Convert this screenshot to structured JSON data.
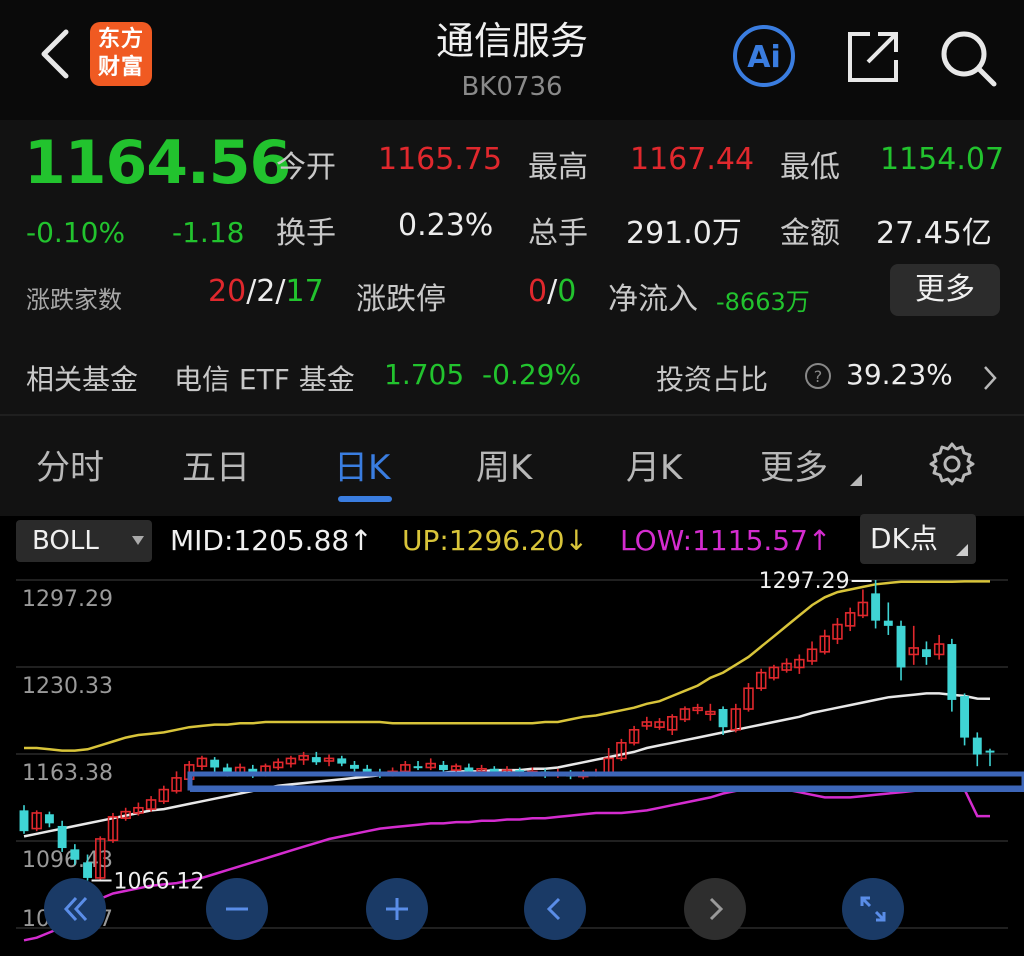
{
  "header": {
    "title": "通信服务",
    "code": "BK0736",
    "logo_line1": "东方",
    "logo_line2": "财富",
    "ai_label": "Ai"
  },
  "quote": {
    "price": "1164.56",
    "change_pct": "-0.10%",
    "change_val": "-1.18",
    "open_label": "今开",
    "open": "1165.75",
    "high_label": "最高",
    "high": "1167.44",
    "low_label": "最低",
    "low": "1154.07",
    "turnover_label": "换手",
    "turnover": "0.23%",
    "volume_label": "总手",
    "volume": "291.0万",
    "amount_label": "金额",
    "amount": "27.45亿",
    "breadth_label": "涨跌家数",
    "breadth_up": "20",
    "breadth_sep1": "/",
    "breadth_flat": "2",
    "breadth_sep2": "/",
    "breadth_down": "17",
    "limit_label": "涨跌停",
    "limit_up": "0",
    "limit_sep": "/",
    "limit_down": "0",
    "netflow_label": "净流入",
    "netflow": "-8663万",
    "more": "更多"
  },
  "fund": {
    "label": "相关基金",
    "name": "电信 ETF 基金",
    "price": "1.705",
    "change": "-0.29%",
    "ratio_label": "投资占比",
    "ratio": "39.23%"
  },
  "tabs": [
    "分时",
    "五日",
    "日K",
    "周K",
    "月K",
    "更多"
  ],
  "active_tab": "日K",
  "indicator": {
    "name": "BOLL",
    "mid": "MID:1205.88",
    "mid_arrow": "↑",
    "up": "UP:1296.20",
    "up_arrow": "↓",
    "low": "LOW:1115.57",
    "low_arrow": "↑",
    "dk_label": "DK点"
  },
  "chart_labels": {
    "y1": "1297.29",
    "y2": "1230.33",
    "y3": "1163.38",
    "y4": "1096.43",
    "y5": "1029.47",
    "high_marker": "1297.29",
    "low_marker": "1066.12"
  },
  "colors": {
    "up": "#e0282d",
    "down": "#3fd4d4",
    "upper_band": "#d8c43a",
    "mid_band": "#e8e8e8",
    "lower_band": "#d42ccf",
    "accent": "#3a7de0"
  },
  "chart_data": {
    "type": "candlestick",
    "indicator": "BOLL",
    "ylim": [
      1029.47,
      1297.29
    ],
    "y_ticks": [
      1297.29,
      1230.33,
      1163.38,
      1096.43,
      1029.47
    ],
    "candles": [
      {
        "o": 1120,
        "c": 1104,
        "h": 1124,
        "l": 1102
      },
      {
        "o": 1106,
        "c": 1118,
        "h": 1120,
        "l": 1104
      },
      {
        "o": 1117,
        "c": 1110,
        "h": 1119,
        "l": 1107
      },
      {
        "o": 1108,
        "c": 1091,
        "h": 1112,
        "l": 1088
      },
      {
        "o": 1090,
        "c": 1082,
        "h": 1094,
        "l": 1078
      },
      {
        "o": 1080,
        "c": 1068,
        "h": 1086,
        "l": 1066
      },
      {
        "o": 1068,
        "c": 1098,
        "h": 1100,
        "l": 1066
      },
      {
        "o": 1097,
        "c": 1115,
        "h": 1118,
        "l": 1095
      },
      {
        "o": 1114,
        "c": 1119,
        "h": 1122,
        "l": 1112
      },
      {
        "o": 1118,
        "c": 1122,
        "h": 1126,
        "l": 1116
      },
      {
        "o": 1121,
        "c": 1128,
        "h": 1131,
        "l": 1119
      },
      {
        "o": 1127,
        "c": 1136,
        "h": 1139,
        "l": 1125
      },
      {
        "o": 1135,
        "c": 1145,
        "h": 1150,
        "l": 1133
      },
      {
        "o": 1144,
        "c": 1155,
        "h": 1158,
        "l": 1142
      },
      {
        "o": 1154,
        "c": 1160,
        "h": 1162,
        "l": 1151
      },
      {
        "o": 1159,
        "c": 1153,
        "h": 1161,
        "l": 1149
      },
      {
        "o": 1153,
        "c": 1148,
        "h": 1156,
        "l": 1146
      },
      {
        "o": 1149,
        "c": 1153,
        "h": 1156,
        "l": 1147
      },
      {
        "o": 1152,
        "c": 1147,
        "h": 1155,
        "l": 1145
      },
      {
        "o": 1148,
        "c": 1154,
        "h": 1156,
        "l": 1146
      },
      {
        "o": 1153,
        "c": 1157,
        "h": 1160,
        "l": 1151
      },
      {
        "o": 1156,
        "c": 1160,
        "h": 1162,
        "l": 1153
      },
      {
        "o": 1159,
        "c": 1162,
        "h": 1165,
        "l": 1155
      },
      {
        "o": 1161,
        "c": 1157,
        "h": 1165,
        "l": 1155
      },
      {
        "o": 1158,
        "c": 1160,
        "h": 1163,
        "l": 1154
      },
      {
        "o": 1160,
        "c": 1156,
        "h": 1162,
        "l": 1154
      },
      {
        "o": 1155,
        "c": 1152,
        "h": 1158,
        "l": 1150
      },
      {
        "o": 1152,
        "c": 1149,
        "h": 1155,
        "l": 1147
      },
      {
        "o": 1149,
        "c": 1147,
        "h": 1152,
        "l": 1145
      },
      {
        "o": 1148,
        "c": 1150,
        "h": 1153,
        "l": 1146
      },
      {
        "o": 1150,
        "c": 1155,
        "h": 1158,
        "l": 1148
      },
      {
        "o": 1154,
        "c": 1153,
        "h": 1158,
        "l": 1151
      },
      {
        "o": 1153,
        "c": 1156,
        "h": 1160,
        "l": 1151
      },
      {
        "o": 1155,
        "c": 1151,
        "h": 1158,
        "l": 1149
      },
      {
        "o": 1151,
        "c": 1154,
        "h": 1156,
        "l": 1149
      },
      {
        "o": 1153,
        "c": 1150,
        "h": 1156,
        "l": 1148
      },
      {
        "o": 1150,
        "c": 1152,
        "h": 1155,
        "l": 1148
      },
      {
        "o": 1152,
        "c": 1149,
        "h": 1154,
        "l": 1147
      },
      {
        "o": 1149,
        "c": 1151,
        "h": 1154,
        "l": 1147
      },
      {
        "o": 1151,
        "c": 1148,
        "h": 1153,
        "l": 1146
      },
      {
        "o": 1148,
        "c": 1150,
        "h": 1153,
        "l": 1146
      },
      {
        "o": 1150,
        "c": 1147,
        "h": 1152,
        "l": 1145
      },
      {
        "o": 1147,
        "c": 1149,
        "h": 1152,
        "l": 1145
      },
      {
        "o": 1149,
        "c": 1146,
        "h": 1151,
        "l": 1144
      },
      {
        "o": 1146,
        "c": 1148,
        "h": 1151,
        "l": 1144
      },
      {
        "o": 1148,
        "c": 1149,
        "h": 1152,
        "l": 1146
      },
      {
        "o": 1149,
        "c": 1160,
        "h": 1168,
        "l": 1147
      },
      {
        "o": 1160,
        "c": 1172,
        "h": 1175,
        "l": 1158
      },
      {
        "o": 1172,
        "c": 1182,
        "h": 1185,
        "l": 1170
      },
      {
        "o": 1185,
        "c": 1188,
        "h": 1192,
        "l": 1182
      },
      {
        "o": 1184,
        "c": 1188,
        "h": 1191,
        "l": 1182
      },
      {
        "o": 1182,
        "c": 1192,
        "h": 1194,
        "l": 1178
      },
      {
        "o": 1190,
        "c": 1198,
        "h": 1200,
        "l": 1188
      },
      {
        "o": 1197,
        "c": 1199,
        "h": 1202,
        "l": 1194
      },
      {
        "o": 1194,
        "c": 1196,
        "h": 1202,
        "l": 1189
      },
      {
        "o": 1198,
        "c": 1184,
        "h": 1200,
        "l": 1178
      },
      {
        "o": 1182,
        "c": 1198,
        "h": 1202,
        "l": 1180
      },
      {
        "o": 1198,
        "c": 1214,
        "h": 1218,
        "l": 1196
      },
      {
        "o": 1214,
        "c": 1226,
        "h": 1229,
        "l": 1212
      },
      {
        "o": 1222,
        "c": 1230,
        "h": 1232,
        "l": 1220
      },
      {
        "o": 1228,
        "c": 1233,
        "h": 1237,
        "l": 1226
      },
      {
        "o": 1230,
        "c": 1236,
        "h": 1240,
        "l": 1225
      },
      {
        "o": 1235,
        "c": 1244,
        "h": 1250,
        "l": 1232
      },
      {
        "o": 1242,
        "c": 1254,
        "h": 1259,
        "l": 1240
      },
      {
        "o": 1252,
        "c": 1263,
        "h": 1268,
        "l": 1248
      },
      {
        "o": 1262,
        "c": 1272,
        "h": 1276,
        "l": 1258
      },
      {
        "o": 1270,
        "c": 1280,
        "h": 1290,
        "l": 1268
      },
      {
        "o": 1287,
        "c": 1266,
        "h": 1297.29,
        "l": 1260
      },
      {
        "o": 1266,
        "c": 1262,
        "h": 1280,
        "l": 1255
      },
      {
        "o": 1262,
        "c": 1230,
        "h": 1266,
        "l": 1220
      },
      {
        "o": 1240,
        "c": 1245,
        "h": 1262,
        "l": 1232
      },
      {
        "o": 1244,
        "c": 1238,
        "h": 1250,
        "l": 1232
      },
      {
        "o": 1240,
        "c": 1248,
        "h": 1255,
        "l": 1236
      },
      {
        "o": 1248,
        "c": 1205,
        "h": 1252,
        "l": 1196
      },
      {
        "o": 1208,
        "c": 1176,
        "h": 1210,
        "l": 1170
      },
      {
        "o": 1176,
        "c": 1163,
        "h": 1180,
        "l": 1154
      },
      {
        "o": 1166,
        "c": 1164.56,
        "h": 1167.44,
        "l": 1154.07
      }
    ],
    "upper": [
      1168,
      1168,
      1167,
      1166,
      1166,
      1167,
      1170,
      1173,
      1176,
      1178,
      1179,
      1180,
      1182,
      1184,
      1185,
      1186,
      1186,
      1187,
      1187,
      1188,
      1188,
      1188,
      1188,
      1188,
      1188,
      1188,
      1188,
      1188,
      1188,
      1187,
      1187,
      1187,
      1187,
      1187,
      1187,
      1187,
      1187,
      1187,
      1187,
      1187,
      1187,
      1188,
      1188,
      1190,
      1192,
      1193,
      1195,
      1197,
      1199,
      1202,
      1204,
      1208,
      1212,
      1216,
      1222,
      1226,
      1232,
      1238,
      1246,
      1254,
      1262,
      1270,
      1278,
      1284,
      1288,
      1290,
      1292,
      1294,
      1295,
      1296,
      1296,
      1296,
      1296,
      1296,
      1296.2,
      1296.2,
      1296.2
    ],
    "mid": [
      1100,
      1102,
      1104,
      1106,
      1108,
      1110,
      1112,
      1114,
      1116,
      1118,
      1120,
      1121,
      1123,
      1125,
      1127,
      1129,
      1131,
      1133,
      1135,
      1137,
      1139,
      1140,
      1141,
      1142,
      1143,
      1144,
      1145,
      1146,
      1147,
      1147,
      1148,
      1148,
      1149,
      1149,
      1150,
      1150,
      1150,
      1151,
      1151,
      1151,
      1152,
      1152,
      1153,
      1155,
      1157,
      1159,
      1161,
      1163,
      1165,
      1168,
      1170,
      1172,
      1174,
      1176,
      1178,
      1180,
      1182,
      1184,
      1186,
      1188,
      1190,
      1192,
      1195,
      1197,
      1199,
      1201,
      1203,
      1205,
      1207,
      1208,
      1209,
      1210,
      1210,
      1209,
      1208,
      1206,
      1205.88
    ],
    "lower": [
      1020,
      1022,
      1026,
      1030,
      1038,
      1046,
      1052,
      1056,
      1058,
      1060,
      1062,
      1063,
      1064,
      1066,
      1068,
      1071,
      1074,
      1077,
      1080,
      1083,
      1086,
      1089,
      1092,
      1095,
      1098,
      1100,
      1102,
      1104,
      1106,
      1107,
      1108,
      1109,
      1110,
      1110,
      1111,
      1111,
      1112,
      1112,
      1113,
      1113,
      1114,
      1114,
      1115,
      1116,
      1117,
      1118,
      1118,
      1118,
      1119,
      1120,
      1122,
      1124,
      1126,
      1128,
      1130,
      1133,
      1135,
      1136,
      1137,
      1137,
      1136,
      1134,
      1132,
      1130,
      1130,
      1130,
      1131,
      1132,
      1133,
      1134,
      1135,
      1136,
      1136,
      1136,
      1136,
      1115.57,
      1115.57
    ]
  }
}
